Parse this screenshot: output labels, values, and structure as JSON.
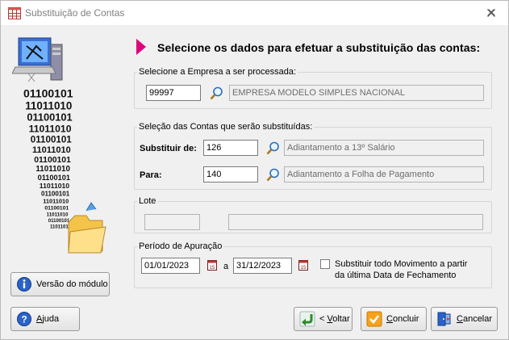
{
  "window": {
    "title": "Substituição de Contas",
    "close_icon": "close-icon"
  },
  "heading": "Selecione os dados para efetuar a substituição das contas:",
  "empresa": {
    "legend": "Selecione a Empresa a ser processada:",
    "code": "99997",
    "name": "EMPRESA MODELO SIMPLES NACIONAL"
  },
  "contas": {
    "legend": "Seleção das Contas que serão substituídas:",
    "substituir_label": "Substituir de:",
    "substituir_code": "126",
    "substituir_desc": "Adiantamento a 13º Salário",
    "para_label": "Para:",
    "para_code": "140",
    "para_desc": "Adiantamento a Folha de Pagamento"
  },
  "lote": {
    "legend": "Lote",
    "field1": "",
    "field2": ""
  },
  "periodo": {
    "legend": "Período de Apuração",
    "start": "01/01/2023",
    "separator": "a",
    "end": "31/12/2023",
    "checkbox_label_line1": "Substituir todo Movimento a partir",
    "checkbox_label_line2": "da última Data de Fechamento",
    "checkbox_checked": false
  },
  "art": {
    "binary_rows": [
      "01100101",
      "11011010",
      "01100101",
      "11011010",
      "01100101",
      "11011010",
      "01100101",
      "11011010",
      "01100101",
      "11011010",
      "01100101",
      "11011010",
      "01100101",
      "11011010",
      "01100101",
      "11011010"
    ]
  },
  "buttons": {
    "versao": "Versão do módulo",
    "ajuda_u": "A",
    "ajuda_rest": "juda",
    "voltar_pre": "< ",
    "voltar_u": "V",
    "voltar_rest": "oltar",
    "concluir_u": "C",
    "concluir_rest": "oncluir",
    "cancelar_u": "C",
    "cancelar_rest": "ancelar"
  },
  "colors": {
    "accent_marker": "#e0007a",
    "info_blue": "#2a63c8"
  }
}
